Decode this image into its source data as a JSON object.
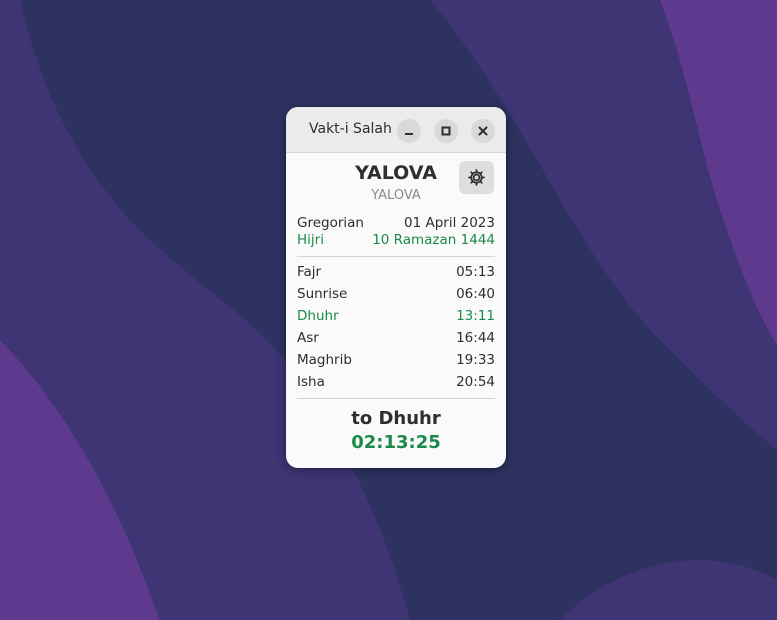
{
  "window": {
    "title": "Vakt-i Salah"
  },
  "location": {
    "city": "YALOVA",
    "region": "YALOVA"
  },
  "dates": {
    "gregorian_label": "Gregorian",
    "gregorian_value": "01 April 2023",
    "hijri_label": "Hijri",
    "hijri_value": "10 Ramazan 1444"
  },
  "prayers": [
    {
      "name": "Fajr",
      "time": "05:13"
    },
    {
      "name": "Sunrise",
      "time": "06:40"
    },
    {
      "name": "Dhuhr",
      "time": "13:11"
    },
    {
      "name": "Asr",
      "time": "16:44"
    },
    {
      "name": "Maghrib",
      "time": "19:33"
    },
    {
      "name": "Isha",
      "time": "20:54"
    }
  ],
  "next": {
    "label": "to Dhuhr",
    "countdown": "02:13:25"
  },
  "icons": {
    "minimize": "minimize-icon",
    "maximize": "maximize-icon",
    "close": "close-icon",
    "settings": "gear-icon"
  },
  "colors": {
    "accent": "#1a8a4a",
    "wallpaper_dark": "#2d3260",
    "wallpaper_mid": "#3e3370",
    "wallpaper_light": "#5d3a8c"
  }
}
